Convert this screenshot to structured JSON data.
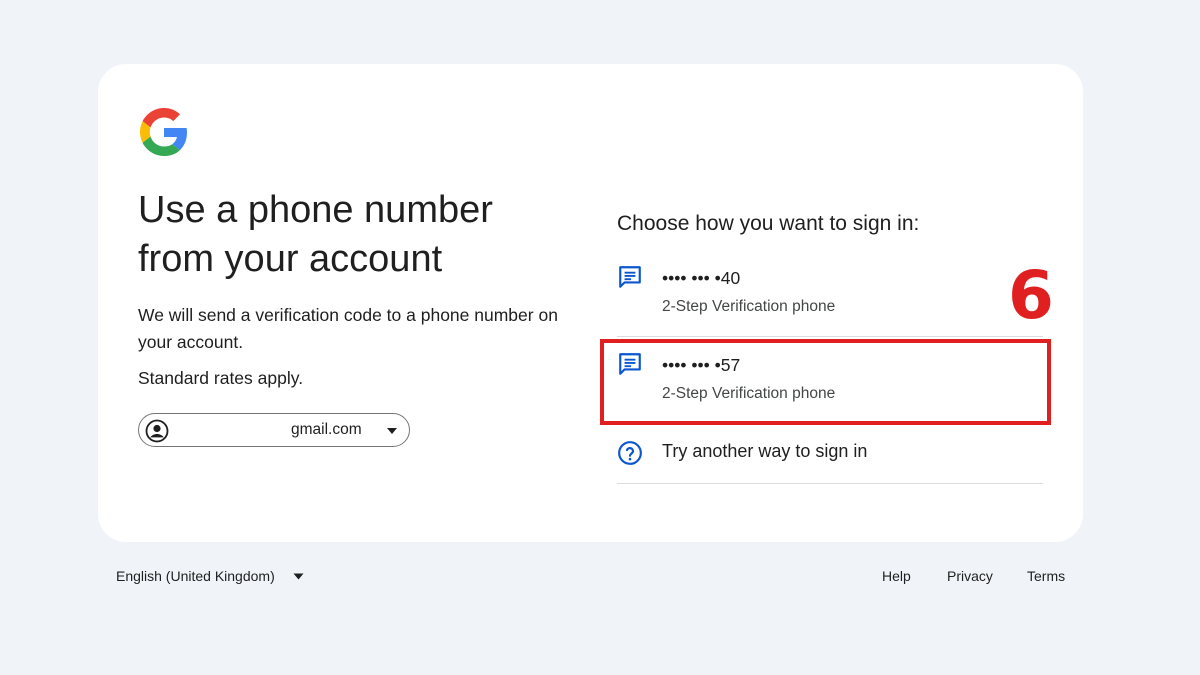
{
  "logo": {
    "icon": "google-g-logo"
  },
  "headline": {
    "line1": "Use a phone number",
    "line2": "from your account"
  },
  "description": "We will send a verification code to a phone number on your account.",
  "rates": "Standard rates apply.",
  "account": {
    "email": "gmail.com",
    "avatar_icon": "account-circle-icon",
    "caret_icon": "caret-down-icon"
  },
  "choose_title": "Choose how you want to sign in:",
  "options": [
    {
      "phone": "•••• ••• •40",
      "subtitle": "2-Step Verification phone",
      "icon": "message-icon"
    },
    {
      "phone": "•••• ••• •57",
      "subtitle": "2-Step Verification phone",
      "icon": "message-icon"
    }
  ],
  "try_another": {
    "label": "Try another way to sign in",
    "icon": "help-circle-icon"
  },
  "annotation": {
    "step": "6",
    "color": "#e02020"
  },
  "footer": {
    "language": "English (United Kingdom)",
    "help": "Help",
    "privacy": "Privacy",
    "terms": "Terms"
  },
  "colors": {
    "background": "#f0f4f9",
    "card": "#ffffff",
    "accent": "#0b57d0",
    "text": "#1f1f1f"
  }
}
